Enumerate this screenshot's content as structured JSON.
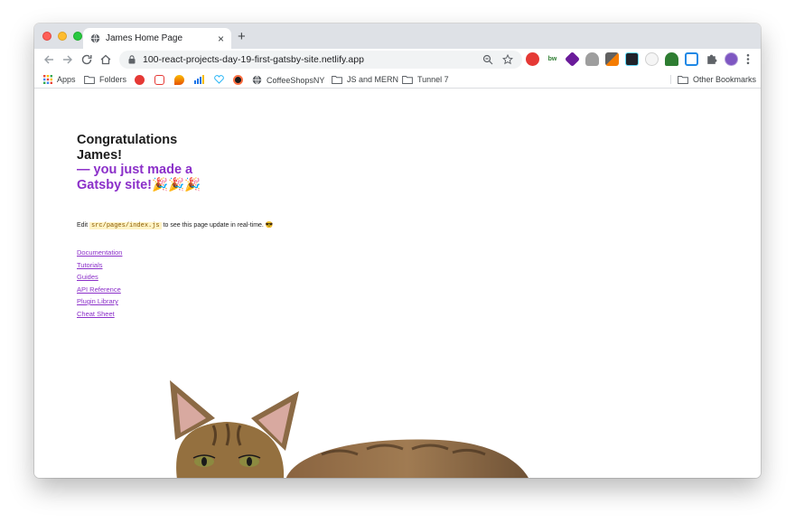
{
  "browser": {
    "tab_title": "James Home Page",
    "tab_close": "×",
    "new_tab": "+",
    "url": "100-react-projects-day-19-first-gatsby-site.netlify.app",
    "extensions": [
      {
        "name": "adblock",
        "color": "#e53935",
        "text": ""
      },
      {
        "name": "bw",
        "color": "#ffffff",
        "text": "bw"
      },
      {
        "name": "stack",
        "color": "#6a1b9a",
        "text": ""
      },
      {
        "name": "drive",
        "color": "#9e9e9e",
        "text": ""
      },
      {
        "name": "eyedropper",
        "color": "#f57c00",
        "text": ""
      },
      {
        "name": "react",
        "color": "#20232a",
        "text": ""
      },
      {
        "name": "moon",
        "color": "#eeeeee",
        "text": ""
      },
      {
        "name": "tree",
        "color": "#2e7d32",
        "text": ""
      },
      {
        "name": "window",
        "color": "#1e88e5",
        "text": ""
      },
      {
        "name": "puzzle",
        "color": "#5f6368",
        "text": ""
      },
      {
        "name": "avatar",
        "color": "#7e57c2",
        "text": ""
      }
    ]
  },
  "bookmarks": {
    "apps": "Apps",
    "folders": "Folders",
    "coffee": "CoffeeShopsNY",
    "js_mern": "JS and MERN",
    "tunnel": "Tunnel 7",
    "other": "Other Bookmarks"
  },
  "page": {
    "heading_line1": "Congratulations",
    "heading_line2": "James!",
    "heading_line3": "— you just made a",
    "heading_line4": "Gatsby site!🎉🎉🎉",
    "edit_prefix": "Edit ",
    "edit_code": "src/pages/index.js",
    "edit_suffix": " to see this page update in real-time. 😎",
    "links": [
      "Documentation",
      "Tutorials",
      "Guides",
      "API Reference",
      "Plugin Library",
      "Cheat Sheet"
    ]
  }
}
